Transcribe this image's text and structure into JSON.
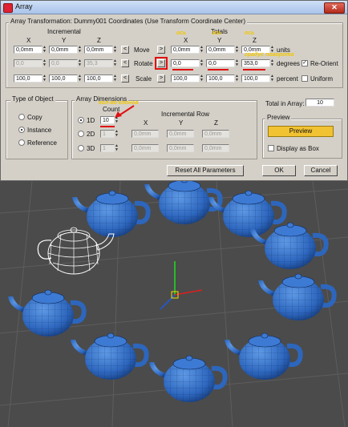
{
  "window": {
    "title": "Array",
    "close_glyph": "✕"
  },
  "transform": {
    "heading": "Array Transformation: Dummy001 Coordinates (Use Transform Coordinate Center)",
    "incremental_label": "Incremental",
    "totals_label": "Totals",
    "axis_labels": [
      "X",
      "Y",
      "Z"
    ],
    "move": {
      "label": "Move",
      "inc": [
        "0,0mm",
        "0,0mm",
        "0,0mm"
      ],
      "tot": [
        "0,0mm",
        "0,0mm",
        "0,0mm"
      ],
      "unit": "units"
    },
    "rotate": {
      "label": "Rotate",
      "inc": [
        "0,0",
        "0,0",
        "35,3"
      ],
      "tot": [
        "0,0",
        "0,0",
        "353,0"
      ],
      "unit": "degrees"
    },
    "scale": {
      "label": "Scale",
      "inc": [
        "100,0",
        "100,0",
        "100,0"
      ],
      "tot": [
        "100,0",
        "100,0",
        "100,0"
      ],
      "unit": "percent"
    },
    "arrow_left": "<",
    "arrow_right": ">",
    "reorient_label": "Re-Orient",
    "reorient_checked": true,
    "uniform_label": "Uniform",
    "uniform_checked": false
  },
  "annotations": {
    "axis_1": "ось",
    "axis_2": "ось",
    "axis_3": "ось",
    "radius": "градус поворота",
    "clones": "кол-во клонов"
  },
  "type_of_object": {
    "title": "Type of Object",
    "options": [
      "Copy",
      "Instance",
      "Reference"
    ],
    "selected": "Instance"
  },
  "array_dimensions": {
    "title": "Array Dimensions",
    "count_label": "Count",
    "incremental_row_label": "Incremental Row",
    "axis_labels": [
      "X",
      "Y",
      "Z"
    ],
    "rows": [
      {
        "label": "1D",
        "count": "10",
        "values": []
      },
      {
        "label": "2D",
        "count": "1",
        "values": [
          "0,0mm",
          "0,0mm",
          "0,0mm"
        ]
      },
      {
        "label": "3D",
        "count": "1",
        "values": [
          "0,0mm",
          "0,0mm",
          "0,0mm"
        ]
      }
    ],
    "selected": "1D"
  },
  "total_in_array": {
    "label": "Total in Array:",
    "value": "10"
  },
  "preview": {
    "title": "Preview",
    "button_label": "Preview",
    "display_as_box_label": "Display as Box"
  },
  "footer": {
    "reset_label": "Reset All Parameters",
    "ok_label": "OK",
    "cancel_label": "Cancel"
  },
  "colors": {
    "preview_button": "#f1c232",
    "annotation_text": "#f3c600",
    "annotation_mark": "#e01010",
    "teapot": "#2f70c8",
    "selected_teapot": "#ffffff"
  },
  "viewport": {
    "description_icons": [
      "teapot-ring",
      "transform-gizmo"
    ]
  }
}
